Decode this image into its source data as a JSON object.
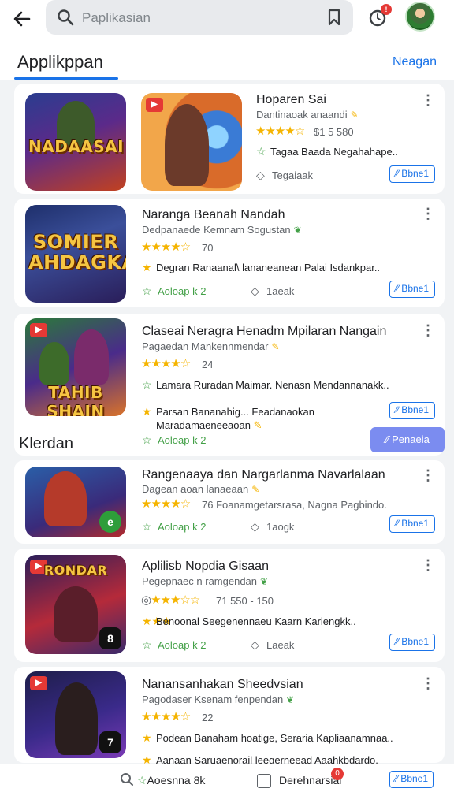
{
  "topbar": {
    "search_placeholder": "Paplikasian",
    "notification_count": "!"
  },
  "section": {
    "title": "Applikppan",
    "see_all": "Neagan"
  },
  "side_label": "Klerdan",
  "float_button": "⁄⁄ Penaeia",
  "cards": [
    {
      "name": "Hoparen Sai",
      "developer": "Dantinaoak anaandi",
      "stars": "★★★★☆",
      "rating": "$1 5 580",
      "desc": "Tagaa Baada Negahahape..",
      "meta_left": "",
      "meta_right": "Tegaiaak",
      "install": "⁄⁄ Bbne1"
    },
    {
      "name": "Naranga Beanah Nandah",
      "developer": "Dedpanaede Kemnam Sogustan",
      "stars": "★★★★☆",
      "rating": "70",
      "desc": "Degran Ranaanal\\ lananeanean Palai Isdankpar..",
      "meta_left": "Aoloap k 2",
      "meta_right": "1aeak",
      "install": "⁄⁄ Bbne1"
    },
    {
      "name": "Claseai Neragra Henadm Mpilaran Nangain",
      "developer": "Pagaedan Mankennmendar",
      "stars": "★★★★☆",
      "rating": "24",
      "desc": "Lamara Ruradan Maimar. Nenasn Mendannanakk..",
      "desc2": "Parsan Bananahig... Feadanaokan",
      "desc3": "Maradamaeneeaoan",
      "meta_left": "Aoloap k 2",
      "install": "⁄⁄ Bbne1"
    },
    {
      "name": "Rangenaaya dan Nargarlanma Navarlalaan",
      "developer": "Dagean aoan lanaeaan",
      "stars": "★★★★☆",
      "rating": "76 Foanamgetarsrasa, Nagna Pagbindo.",
      "meta_left": "Aoloap k 2",
      "meta_right": "1aogk",
      "install": "⁄⁄ Bbne1"
    },
    {
      "name": "Aplilisb Nopdia Gisaan",
      "developer": "Pegepnaec n ramgendan",
      "stars": "★★★☆☆",
      "rating": "71 550 - 150",
      "desc": "Benoonal Seegenennaeu Kaarn Kariengkk..",
      "meta_left": "Aoloap k 2",
      "meta_right": "Laeak",
      "install": "⁄⁄ Bbne1"
    },
    {
      "name": "Nanansanhakan Sheedvsian",
      "developer": "Pagodaser Ksenam fenpendan",
      "stars": "★★★★☆",
      "rating": "22",
      "desc": "Podean Banaham hoatige, Seraria Kapliaanamnaa..",
      "desc2": "Aanaan Saruaenorail leegerneead Aaahkbdardo.",
      "install": "⁄⁄ Bbne1"
    }
  ],
  "bottom_bar": {
    "search_label": "Aoesnna 8k",
    "center_label": "Derehnarsiai",
    "badge": "0",
    "button": "⁄⁄ Bbne1"
  },
  "thumbnails": {
    "t1": "NADAASAI",
    "t2": "SOMIER AHDAGKA",
    "t3": "TAHIB SHAIN"
  }
}
